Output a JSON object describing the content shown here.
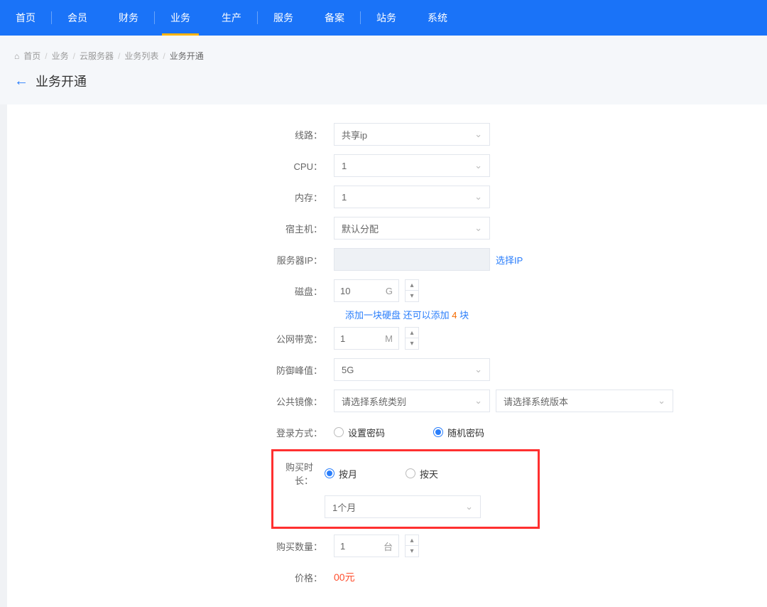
{
  "nav": {
    "items": [
      "首页",
      "会员",
      "财务",
      "业务",
      "生产",
      "服务",
      "备案",
      "站务",
      "系统"
    ],
    "active_index": 3,
    "separators_after": [
      0,
      2,
      4,
      6
    ]
  },
  "breadcrumb": {
    "home_icon": "⌂",
    "items": [
      "首页",
      "业务",
      "云服务器",
      "业务列表"
    ],
    "current": "业务开通"
  },
  "page": {
    "title": "业务开通",
    "back_arrow": "←"
  },
  "form": {
    "line": {
      "label": "线路：",
      "value": "共享ip"
    },
    "cpu": {
      "label": "CPU：",
      "value": "1"
    },
    "memory": {
      "label": "内存：",
      "value": "1"
    },
    "host": {
      "label": "宿主机：",
      "value": "默认分配"
    },
    "server_ip": {
      "label": "服务器IP：",
      "pick_label": "选择IP"
    },
    "disk": {
      "label": "磁盘：",
      "value": "10",
      "unit": "G",
      "note_prefix": "添加一块硬盘 还可以添加 ",
      "note_count": "4",
      "note_suffix": " 块"
    },
    "bandwidth": {
      "label": "公网带宽：",
      "value": "1",
      "unit": "M"
    },
    "defense": {
      "label": "防御峰值：",
      "value": "5G"
    },
    "image": {
      "label": "公共镜像：",
      "category_ph": "请选择系统类别",
      "version_ph": "请选择系统版本"
    },
    "login": {
      "label": "登录方式：",
      "opt_set": "设置密码",
      "opt_rand": "随机密码",
      "checked": "rand"
    },
    "duration": {
      "label": "购买时长：",
      "opt_month": "按月",
      "opt_day": "按天",
      "checked": "month",
      "period_value": "1个月"
    },
    "qty": {
      "label": "购买数量：",
      "value": "1",
      "unit": "台"
    },
    "price": {
      "label": "价格：",
      "value": "00元"
    }
  }
}
